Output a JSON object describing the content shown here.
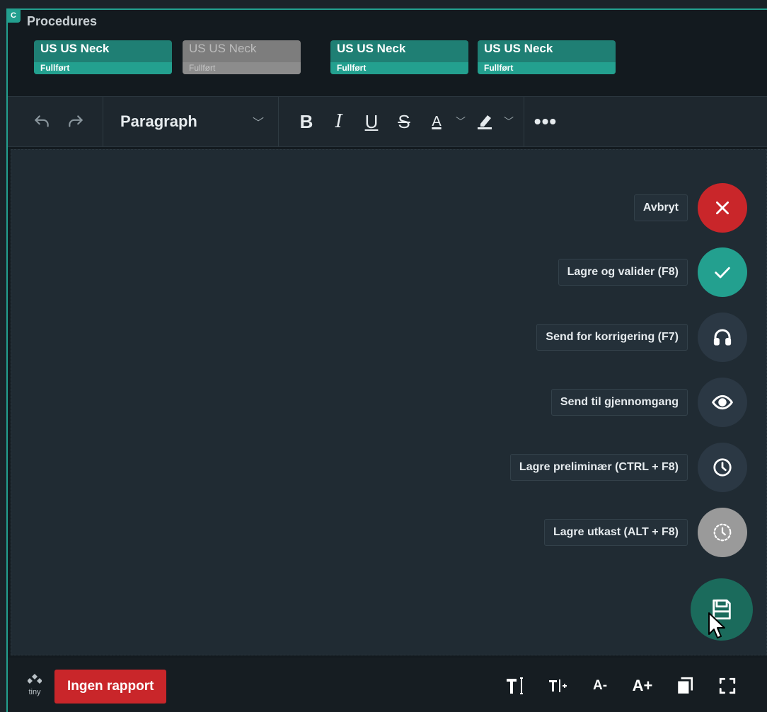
{
  "corner_badge": "C",
  "procedures": {
    "title": "Procedures",
    "chips": [
      {
        "name": "US US Neck",
        "status": "Fullført",
        "enabled": true
      },
      {
        "name": "US US Neck",
        "status": "Fullført",
        "enabled": false
      },
      {
        "name": "US US Neck",
        "status": "Fullført",
        "enabled": true
      },
      {
        "name": "US US Neck",
        "status": "Fullført",
        "enabled": true
      }
    ]
  },
  "toolbar": {
    "format": "Paragraph",
    "bold": "B",
    "italic": "I",
    "underline": "U",
    "strike": "S",
    "text_color": "A",
    "more": "•••"
  },
  "actions": [
    {
      "label": "Avbryt",
      "icon": "close-icon",
      "color": "#c9262a"
    },
    {
      "label": "Lagre og valider (F8)",
      "icon": "check-icon",
      "color": "#23a08f"
    },
    {
      "label": "Send for korrigering (F7)",
      "icon": "headphones-icon",
      "color": "#2b3844"
    },
    {
      "label": "Send til gjennomgang",
      "icon": "eye-icon",
      "color": "#2b3844"
    },
    {
      "label": "Lagre preliminær (CTRL + F8)",
      "icon": "clock-icon",
      "color": "#2b3844"
    },
    {
      "label": "Lagre utkast (ALT + F8)",
      "icon": "dashed-clock-icon",
      "color": "#9a9a9a"
    }
  ],
  "main_fab": {
    "icon": "save-icon",
    "color": "#1b6b5c"
  },
  "statusbar": {
    "logo_text": "tiny",
    "no_report": "Ingen rapport",
    "font_smaller": "A-",
    "font_larger": "A+"
  },
  "colors": {
    "accent": "#23a08f",
    "danger": "#c9262a",
    "background": "#202b33"
  }
}
